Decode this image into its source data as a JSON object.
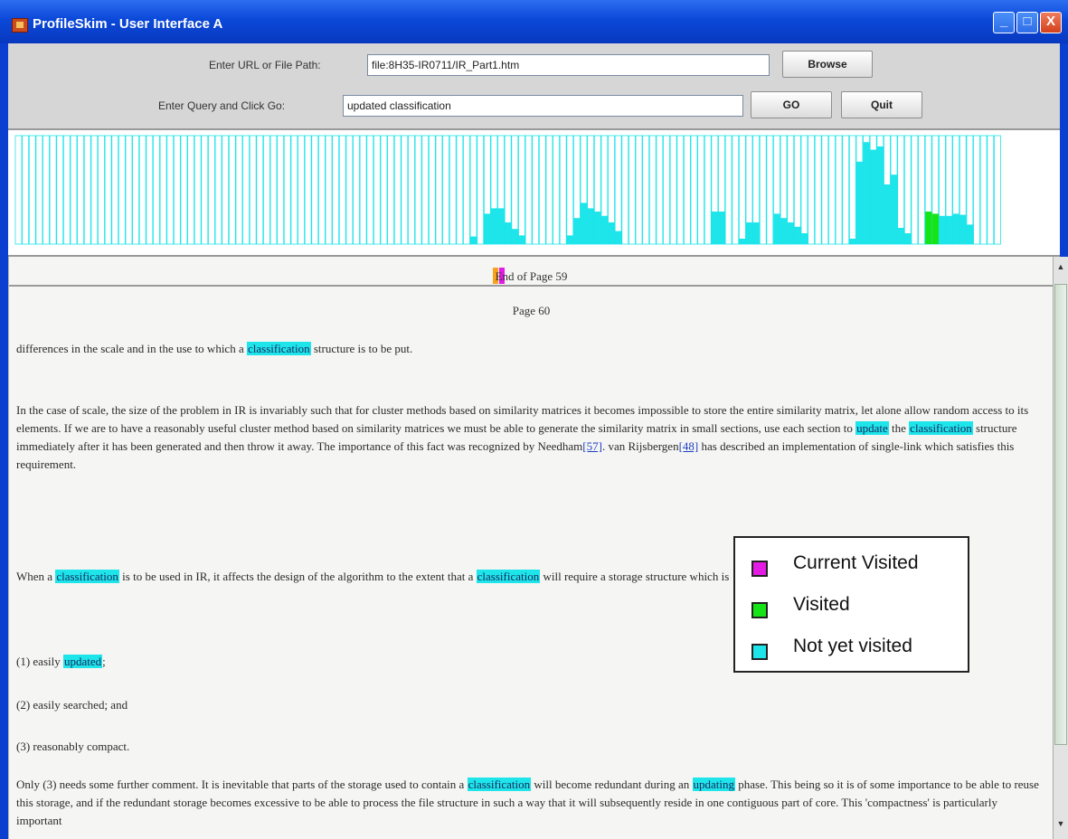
{
  "window": {
    "title": "ProfileSkim - User Interface A",
    "controls": [
      "_",
      "□",
      "X"
    ]
  },
  "controls": {
    "url_label": "Enter URL or File Path:",
    "url_value": "file:8H35-IR0711/IR_Part1.htm",
    "browse_label": "Browse",
    "query_label": "Enter Query and Click Go:",
    "query_value": "updated classification",
    "go_label": "GO",
    "quit_label": "Quit"
  },
  "overview": {
    "colors": {
      "not_visited": "#1de5ea",
      "visited": "#16e416",
      "current": "#e41be4",
      "grid": "#1de5ea",
      "background": "#ffffff"
    },
    "bars": [
      0,
      0,
      0,
      0,
      0,
      0,
      0,
      0,
      0,
      0,
      0,
      0,
      0,
      0,
      0,
      0,
      0,
      0,
      0,
      0,
      0,
      0,
      0,
      0,
      0,
      0,
      0,
      0,
      0,
      0,
      0,
      0,
      0,
      0,
      0,
      0,
      0,
      0,
      0,
      0,
      0,
      0,
      0,
      0,
      0,
      0,
      0,
      0,
      0,
      0,
      0,
      0,
      0,
      0,
      0,
      0,
      0,
      0,
      0,
      0,
      0,
      0,
      0,
      0,
      0,
      0,
      0.07,
      0,
      0.28,
      0.33,
      0.33,
      0.2,
      0.14,
      0.08,
      0,
      0,
      0,
      0,
      0,
      0,
      0.08,
      0.24,
      0.38,
      0.33,
      0.3,
      0.26,
      0.2,
      0.12,
      0,
      0,
      0,
      0,
      0,
      0,
      0,
      0,
      0,
      0,
      0,
      0,
      0,
      0.3,
      0.3,
      0,
      0,
      0.05,
      0.2,
      0.2,
      0,
      0,
      0.28,
      0.24,
      0.2,
      0.16,
      0.1,
      0,
      0,
      0,
      0,
      0,
      0,
      0.05,
      0.76,
      0.94,
      0.87,
      0.9,
      0.55,
      0.64,
      0.15,
      0.1,
      0,
      0,
      0.3,
      0.28,
      0.26,
      0.26,
      0.28,
      0.27,
      0.18,
      0,
      0,
      0,
      0
    ],
    "states": {
      "visited": [
        131,
        132,
        133
      ],
      "current": [
        139
      ]
    }
  },
  "content": {
    "end_of_page": "End of Page 59",
    "page_number": "Page 60",
    "paragraphs": [
      {
        "parts": [
          {
            "text": "differences in the scale and in the use to which a "
          },
          {
            "text": "classification",
            "hl": true
          },
          {
            "text": " structure is to be put."
          }
        ]
      },
      {
        "parts": [
          {
            "text": "In the case of scale, the size of the problem in IR is invariably such that for cluster methods based on similarity matrices it becomes impossible to store the entire similarity matrix, let alone allow random access to its elements.  If we are to have a reasonably useful cluster method based on similarity matrices we must be able to generate the similarity matrix in small sections, use each section to "
          },
          {
            "text": "update",
            "hl": true
          },
          {
            "text": " the "
          },
          {
            "text": "classification",
            "hl": true
          },
          {
            "text": " structure immediately after it has been generated and then throw it away.  The importance of this fact was recognized by Needham"
          },
          {
            "text": "[57]",
            "link": true
          },
          {
            "text": ".  van Rijsbergen"
          },
          {
            "text": "[48]",
            "link": true
          },
          {
            "text": " has described an implementation of single-link which satisfies this requirement."
          }
        ]
      },
      {
        "parts": [
          {
            "text": "When a "
          },
          {
            "text": "classification",
            "hl": true
          },
          {
            "text": " is to be used in IR, it affects the design of the algorithm to the extent that a "
          },
          {
            "text": "classification",
            "hl": true
          },
          {
            "text": " will require a storage structure which is"
          }
        ]
      },
      {
        "parts": [
          {
            "text": "(1) easily "
          },
          {
            "text": "updated",
            "hl": true
          },
          {
            "text": ";"
          }
        ]
      },
      {
        "parts": [
          {
            "text": "(2) easily searched; and"
          }
        ]
      },
      {
        "parts": [
          {
            "text": "(3) reasonably compact."
          }
        ]
      },
      {
        "parts": [
          {
            "text": "Only (3) needs some further comment.  It is inevitable that parts of the storage used to contain a "
          },
          {
            "text": "classification",
            "hl": true
          },
          {
            "text": " will become redundant during an "
          },
          {
            "text": "updating",
            "hl": true
          },
          {
            "text": " phase.  This being so it is of some importance to be able to reuse this storage, and if the redundant storage becomes excessive to be able to process the file structure in such a way that it will subsequently reside in one contiguous part of core.  This 'compactness' is particularly important"
          }
        ]
      }
    ]
  },
  "legend": {
    "items": [
      {
        "label": "Current Visited",
        "color": "#e41be4"
      },
      {
        "label": "Visited",
        "color": "#16e416"
      },
      {
        "label": "Not yet visited",
        "color": "#1de5ea"
      }
    ]
  }
}
